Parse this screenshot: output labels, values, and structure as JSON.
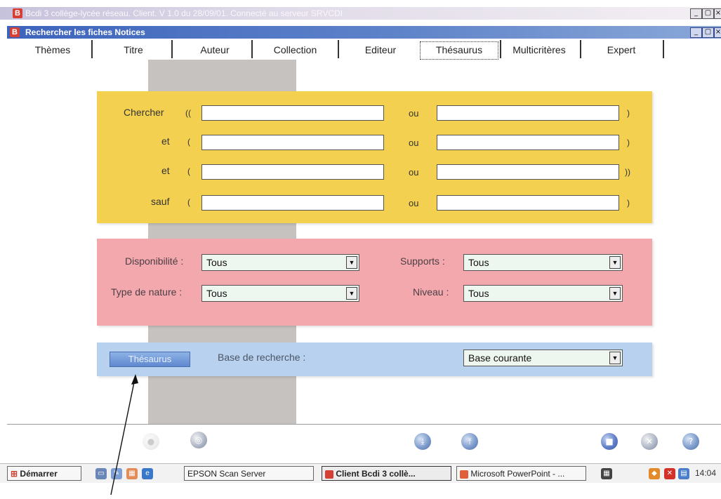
{
  "app": {
    "window_title": "Bcdi 3 collège-lycée réseau. Client. V 1.0 du 28/09/01. Connecté au serveur SRVCDI",
    "dialog_title": "Rechercher les fiches Notices",
    "min_label": "_",
    "max_label": "▢",
    "close_label": "×"
  },
  "tabs": [
    {
      "label": "Thèmes"
    },
    {
      "label": "Titre"
    },
    {
      "label": "Auteur"
    },
    {
      "label": "Collection"
    },
    {
      "label": "Editeur"
    },
    {
      "label": "Thésaurus",
      "active": true
    },
    {
      "label": "Multicritères"
    },
    {
      "label": "Expert"
    }
  ],
  "search": {
    "rows": [
      {
        "label": "Chercher",
        "open": "((",
        "or": "ou",
        "close": ")",
        "value1": "",
        "value2": ""
      },
      {
        "label": "et",
        "open": "(",
        "or": "ou",
        "close": ")",
        "value1": "",
        "value2": ""
      },
      {
        "label": "et",
        "open": "(",
        "or": "ou",
        "close": "))",
        "value1": "",
        "value2": ""
      },
      {
        "label": "sauf",
        "open": "(",
        "or": "ou",
        "close": ")",
        "value1": "",
        "value2": ""
      }
    ]
  },
  "filters": {
    "disponibilite": {
      "label": "Disponibilité :",
      "value": "Tous"
    },
    "type_nature": {
      "label": "Type de nature :",
      "value": "Tous"
    },
    "supports": {
      "label": "Supports :",
      "value": "Tous"
    },
    "niveau": {
      "label": "Niveau :",
      "value": "Tous"
    }
  },
  "base": {
    "button_label": "Thésaurus",
    "label": "Base de recherche :",
    "value": "Base courante"
  },
  "toolbar": {
    "icons": [
      "disabled-icon",
      "disc-icon",
      "import-icon",
      "export-icon",
      "stop-icon",
      "cancel-icon",
      "help-icon"
    ]
  },
  "taskbar": {
    "start_label": "Démarrer",
    "items": [
      {
        "label": "EPSON Scan Server"
      },
      {
        "label": "Client Bcdi 3 collè..."
      },
      {
        "label": "Microsoft PowerPoint - ..."
      }
    ],
    "clock": "14:04"
  },
  "colors": {
    "yellow_panel": "#f3d04f",
    "pink_panel": "#f3a8ae",
    "blue_panel": "#b7d1ee",
    "grey_column": "#c6c2bf"
  }
}
